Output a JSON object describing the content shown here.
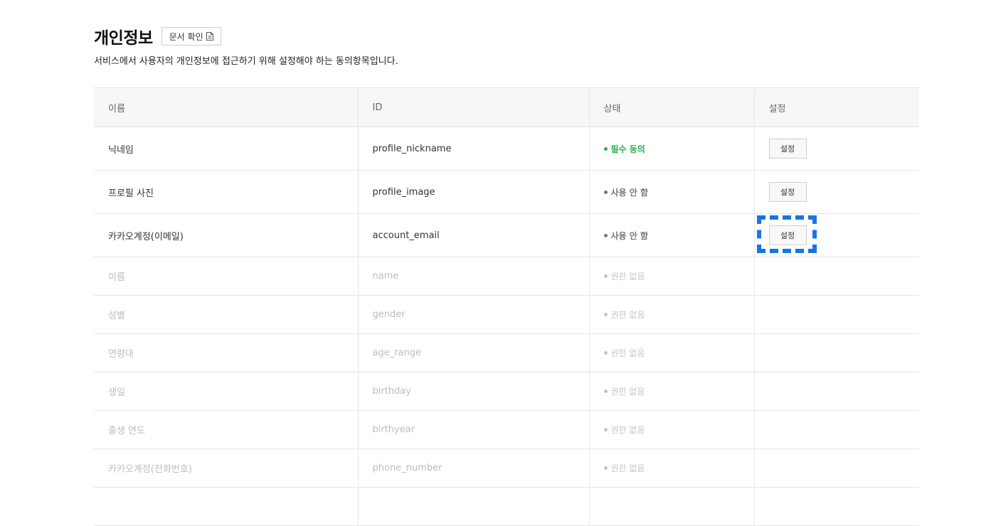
{
  "header": {
    "title": "개인정보",
    "doc_button_label": "문서 확인",
    "description": "서비스에서 사용자의 개인정보에 접근하기 위해 설정해야 하는 동의항목입니다."
  },
  "table": {
    "columns": [
      "이름",
      "ID",
      "상태",
      "설정"
    ],
    "rows": [
      {
        "name": "닉네임",
        "id": "profile_nickname",
        "status": "필수 동의",
        "setting": "설정"
      },
      {
        "name": "프로필 사진",
        "id": "profile_image",
        "status": "사용 안 함",
        "setting": "설정"
      },
      {
        "name": "카카오계정(이메일)",
        "id": "account_email",
        "status": "사용 안 함",
        "setting": "설정"
      },
      {
        "name": "이름",
        "id": "name",
        "status": "권한 없음",
        "setting": ""
      },
      {
        "name": "성별",
        "id": "gender",
        "status": "권한 없음",
        "setting": ""
      },
      {
        "name": "연령대",
        "id": "age_range",
        "status": "권한 없음",
        "setting": ""
      },
      {
        "name": "생일",
        "id": "birthday",
        "status": "권한 없음",
        "setting": ""
      },
      {
        "name": "출생 연도",
        "id": "birthyear",
        "status": "권한 없음",
        "setting": ""
      },
      {
        "name": "카카오계정(전화번호)",
        "id": "phone_number",
        "status": "권한 없음",
        "setting": ""
      }
    ]
  },
  "colors": {
    "required": "#22b14c",
    "unused": "#777777",
    "no_permission": "#c4c4c4",
    "focus_highlight": "#1a73e8"
  },
  "icons": {
    "doc_button": "document-icon",
    "status_marker": "dot-icon"
  }
}
